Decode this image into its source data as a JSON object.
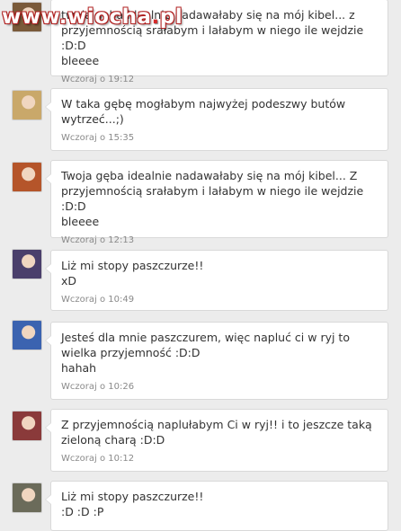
{
  "watermark": {
    "prefix": "www.",
    "brand": "wiocha",
    "dot": ".",
    "suffix": "pl"
  },
  "comments": [
    {
      "text": "twoja gęba idealnie nadawałaby się na mój kibel... z przyjemnością srałabym i lałabym w niego ile wejdzie :D:D\nbleeee",
      "time": "Wczoraj o 19:12",
      "avatar_color": "#7a5a3a"
    },
    {
      "text": "W taka gębę mogłabym najwyżej podeszwy butów wytrzeć...;)",
      "time": "Wczoraj o 15:35",
      "avatar_color": "#c9a86a"
    },
    {
      "text": "Twoja gęba idealnie nadawałaby się na mój kibel... Z przyjemnością srałabym i lałabym w niego ile wejdzie :D:D\nbleeee",
      "time": "Wczoraj o 12:13",
      "avatar_color": "#b5552a"
    },
    {
      "text": "Liż mi stopy paszczurze!!\nxD",
      "time": "Wczoraj o 10:49",
      "avatar_color": "#4a3f6b"
    },
    {
      "text": "Jesteś dla mnie paszczurem, więc napluć ci w ryj to wielka przyjemność :D:D\nhahah",
      "time": "Wczoraj o 10:26",
      "avatar_color": "#3b63b0"
    },
    {
      "text": "Z przyjemnością naplułabym Ci w ryj!! i to jeszcze taką zieloną charą :D:D",
      "time": "Wczoraj o 10:12",
      "avatar_color": "#8a3a3a"
    },
    {
      "text": "Liż mi stopy paszczurze!!\n:D :D :P",
      "time": "",
      "avatar_color": "#6b6b5a"
    }
  ]
}
